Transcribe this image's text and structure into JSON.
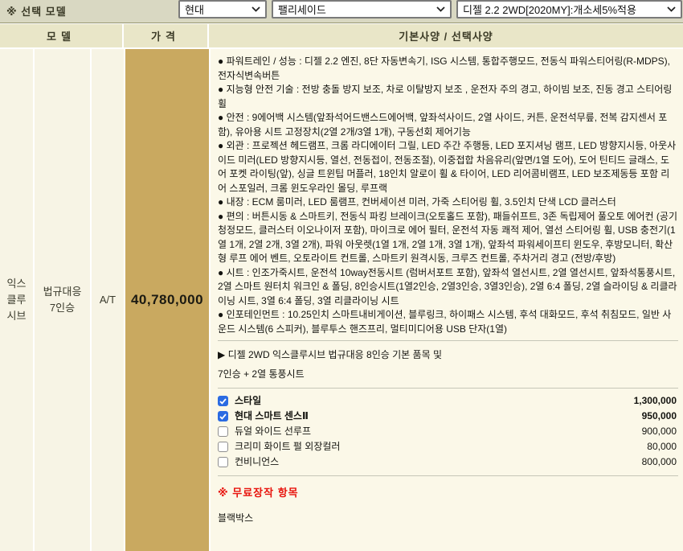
{
  "top": {
    "label": "※ 선택 모델",
    "brand_select": {
      "value": "현대"
    },
    "model_select": {
      "value": "팰리세이드"
    },
    "trim_select": {
      "value": "디젤 2.2 2WD[2020MY]:개소세5%적용"
    }
  },
  "table": {
    "headers": {
      "model": "모델",
      "price": "가격",
      "spec": "기본사양 / 선택사양"
    }
  },
  "row": {
    "trim_lines": [
      "익스",
      "클루",
      "시브"
    ],
    "law_lines": [
      "법규대응",
      "7인승"
    ],
    "transmission": "A/T",
    "price": "40,780,000"
  },
  "spec_paragraphs": [
    "● 파워트레인 / 성능 : 디젤 2.2 엔진, 8단 자동변속기, ISG 시스템, 통합주행모드, 전동식 파워스티어링(R-MDPS), 전자식변속버튼",
    "● 지능형 안전 기술 : 전방 충돌 방지 보조, 차로 이탈방지 보조 , 운전자 주의 경고, 하이빔 보조, 진동 경고 스티어링 휠",
    "● 안전 : 9에어백 시스템(앞좌석어드밴스드에어백, 앞좌석사이드, 2열 사이드, 커튼, 운전석무릎, 전복 감지센서 포함), 유아용 시트 고정장치(2열 2개/3열 1개), 구동선회 제어기능",
    "● 외관 : 프로젝션 헤드램프, 크롬 라디에이터 그릴, LED 주간 주행등, LED 포지셔닝 램프, LED 방향지시등, 아웃사이드 미러(LED 방향지시등, 열선, 전동접이, 전동조절), 이중접합 차음유리(앞면/1열 도어), 도어 틴티드 글래스, 도어 포켓 라이팅(앞), 싱글 트윈팁 머플러, 18인치 알로이 휠 & 타이어, LED 리어콤비램프, LED 보조제동등 포함 리어 스포일러, 크롬 윈도우라인 몰딩, 루프랙",
    "● 내장 : ECM 룸미러, LED 룸램프, 컨버세이션 미러, 가죽 스티어링 휠, 3.5인치 단색 LCD 클러스터",
    "● 편의 : 버튼시동 & 스마트키, 전동식 파킹 브레이크(오토홀드 포함), 패들쉬프트, 3존 독립제어 풀오토 에어컨 (공기청정모드, 클러스터 이오나이저 포함), 마이크로 에어 필터, 운전석 자동 쾌적 제어, 열선 스티어링 휠, USB 충전기(1열 1개, 2열 2개, 3열 2개), 파워 아웃렛(1열 1개, 2열 1개, 3열 1개), 앞좌석 파워세이프티 윈도우, 후방모니터, 확산형 루프 에어 벤트, 오토라이트 컨트롤, 스마트키 원격시동, 크루즈 컨트롤, 주차거리 경고 (전방/후방)",
    "● 시트 : 인조가죽시트, 운전석 10way전동시트 (럼버서포트 포함), 앞좌석 열선시트, 2열 열선시트, 앞좌석통풍시트, 2열 스마트 원터치 워크인 & 폴딩, 8인승시트(1열2인승, 2열3인승, 3열3인승), 2열 6:4 폴딩, 2열 슬라이딩 & 리클라이닝 시트, 3열 6:4 폴딩, 3열 리클라이닝 시트",
    "● 인포테인먼트 : 10.25인치 스마트내비게이션, 블루링크, 하이패스 시스템, 후석 대화모드, 후석 취침모드, 일반 사운드 시스템(6 스피커), 블루투스 핸즈프리, 멀티미디어용 USB 단자(1열)"
  ],
  "base_note": {
    "line1": "▶ 디젤 2WD 익스클루시브 법규대응 8인승 기본 품목 및",
    "line2": "7인승 + 2열 통풍시트"
  },
  "options": [
    {
      "label": "스타일",
      "price": "1,300,000",
      "checked": true
    },
    {
      "label": "현대 스마트 센스Ⅱ",
      "price": "950,000",
      "checked": true
    },
    {
      "label": "듀얼 와이드 선루프",
      "price": "900,000",
      "checked": false
    },
    {
      "label": "크리미 화이트 펄 외장컬러",
      "price": "80,000",
      "checked": false
    },
    {
      "label": "컨비니언스",
      "price": "800,000",
      "checked": false
    }
  ],
  "free_section": {
    "title": "※ 무료장작 항목",
    "items": [
      "블랙박스"
    ]
  },
  "colors": {
    "price_column_bg": "#c9a960",
    "header_bg": "#e9e6c8",
    "spec_bg": "#fbf8e8",
    "model_col_bg": "#f7f4e5",
    "topbar_bg": "#d9d8c2",
    "checkbox_checked": "#2b6be2",
    "free_title_red": "#e8130c"
  }
}
